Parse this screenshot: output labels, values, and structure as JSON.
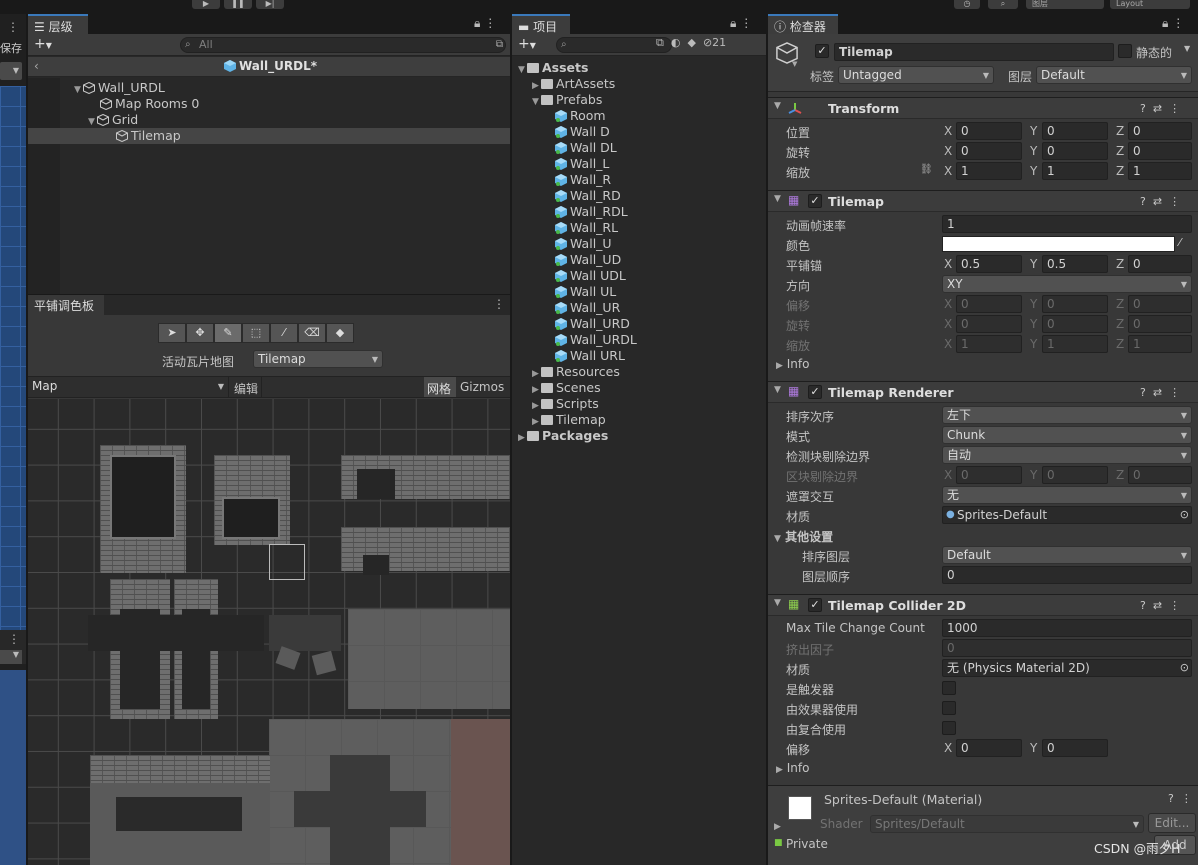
{
  "topbar": {
    "playback": [
      "▶",
      "❚❚",
      "▶|"
    ],
    "layers_label": "图层",
    "layout_label": "Layout"
  },
  "left_strip": {
    "save_label": "保存"
  },
  "hierarchy": {
    "tab": "层级",
    "search_placeholder": "All",
    "scene_title": "Wall_URDL*",
    "items": [
      {
        "label": "Wall_URDL",
        "depth": 0
      },
      {
        "label": "Map Rooms 0",
        "depth": 1
      },
      {
        "label": "Grid",
        "depth": 1
      },
      {
        "label": "Tilemap",
        "depth": 2
      }
    ]
  },
  "palette": {
    "tab": "平铺调色板",
    "active_tilemap_label": "活动瓦片地图",
    "active_tilemap_value": "Tilemap",
    "palette_name": "Map",
    "edit_label": "编辑",
    "grid_label": "网格",
    "gizmos_label": "Gizmos",
    "tools": [
      "select",
      "move",
      "paint",
      "box",
      "picker",
      "erase",
      "fill"
    ]
  },
  "project": {
    "tab": "项目",
    "hidden_count": "21",
    "tree": [
      {
        "label": "Assets",
        "depth": 0,
        "type": "folder",
        "bold": true,
        "open": true
      },
      {
        "label": "ArtAssets",
        "depth": 1,
        "type": "folder"
      },
      {
        "label": "Prefabs",
        "depth": 1,
        "type": "folder",
        "open": true
      },
      {
        "label": "Room",
        "depth": 2,
        "type": "prefab"
      },
      {
        "label": "Wall D",
        "depth": 2,
        "type": "prefab"
      },
      {
        "label": "Wall DL",
        "depth": 2,
        "type": "prefab"
      },
      {
        "label": "Wall_L",
        "depth": 2,
        "type": "prefab"
      },
      {
        "label": "Wall_R",
        "depth": 2,
        "type": "prefab"
      },
      {
        "label": "Wall_RD",
        "depth": 2,
        "type": "prefab"
      },
      {
        "label": "Wall_RDL",
        "depth": 2,
        "type": "prefab"
      },
      {
        "label": "Wall_RL",
        "depth": 2,
        "type": "prefab"
      },
      {
        "label": "Wall_U",
        "depth": 2,
        "type": "prefab"
      },
      {
        "label": "Wall_UD",
        "depth": 2,
        "type": "prefab"
      },
      {
        "label": "Wall UDL",
        "depth": 2,
        "type": "prefab"
      },
      {
        "label": "Wall UL",
        "depth": 2,
        "type": "prefab"
      },
      {
        "label": "Wall_UR",
        "depth": 2,
        "type": "prefab"
      },
      {
        "label": "Wall_URD",
        "depth": 2,
        "type": "prefab"
      },
      {
        "label": "Wall_URDL",
        "depth": 2,
        "type": "prefab"
      },
      {
        "label": "Wall URL",
        "depth": 2,
        "type": "prefab"
      },
      {
        "label": "Resources",
        "depth": 1,
        "type": "folder"
      },
      {
        "label": "Scenes",
        "depth": 1,
        "type": "folder"
      },
      {
        "label": "Scripts",
        "depth": 1,
        "type": "folder"
      },
      {
        "label": "Tilemap",
        "depth": 1,
        "type": "folder"
      },
      {
        "label": "Packages",
        "depth": 0,
        "type": "folder",
        "bold": true
      }
    ]
  },
  "inspector": {
    "tab": "检查器",
    "object_name": "Tilemap",
    "static_label": "静态的",
    "tag_label": "标签",
    "tag_value": "Untagged",
    "layer_label": "图层",
    "layer_value": "Default",
    "transform": {
      "title": "Transform",
      "position_label": "位置",
      "rotation_label": "旋转",
      "scale_label": "缩放",
      "position": [
        "0",
        "0",
        "0"
      ],
      "rotation": [
        "0",
        "0",
        "0"
      ],
      "scale": [
        "1",
        "1",
        "1"
      ]
    },
    "tilemap": {
      "title": "Tilemap",
      "anim_rate_label": "动画帧速率",
      "anim_rate": "1",
      "color_label": "颜色",
      "anchor_label": "平铺锚",
      "anchor": [
        "0.5",
        "0.5",
        "0"
      ],
      "orientation_label": "方向",
      "orientation": "XY",
      "offset_label": "偏移",
      "offset": [
        "0",
        "0",
        "0"
      ],
      "rotation_label": "旋转",
      "rotation": [
        "0",
        "0",
        "0"
      ],
      "scale_label": "缩放",
      "scale": [
        "1",
        "1",
        "1"
      ],
      "info_label": "Info"
    },
    "renderer": {
      "title": "Tilemap Renderer",
      "sort_order_label": "排序次序",
      "sort_order": "左下",
      "mode_label": "模式",
      "mode": "Chunk",
      "detect_cull_label": "检测块剔除边界",
      "detect_cull": "自动",
      "chunk_cull_label": "区块剔除边界",
      "chunk_cull": [
        "0",
        "0",
        "0"
      ],
      "mask_label": "遮罩交互",
      "mask": "无",
      "material_label": "材质",
      "material": "Sprites-Default",
      "other_label": "其他设置",
      "sorting_layer_label": "排序图层",
      "sorting_layer": "Default",
      "order_label": "图层顺序",
      "order": "0"
    },
    "collider": {
      "title": "Tilemap Collider 2D",
      "max_tile_label": "Max Tile Change Count",
      "max_tile": "1000",
      "extrude_label": "挤出因子",
      "extrude": "0",
      "material_label": "材质",
      "material": "无 (Physics Material 2D)",
      "trigger_label": "是触发器",
      "effector_label": "由效果器使用",
      "composite_label": "由复合使用",
      "offset_label": "偏移",
      "offset": [
        "0",
        "0"
      ],
      "info_label": "Info"
    },
    "material_preview": {
      "name": "Sprites-Default (Material)",
      "shader_label": "Shader",
      "shader": "Sprites/Default",
      "edit_label": "Edit...",
      "private_label": "Private",
      "add_label": "Add"
    }
  },
  "watermark": "CSDN @雨夕H"
}
